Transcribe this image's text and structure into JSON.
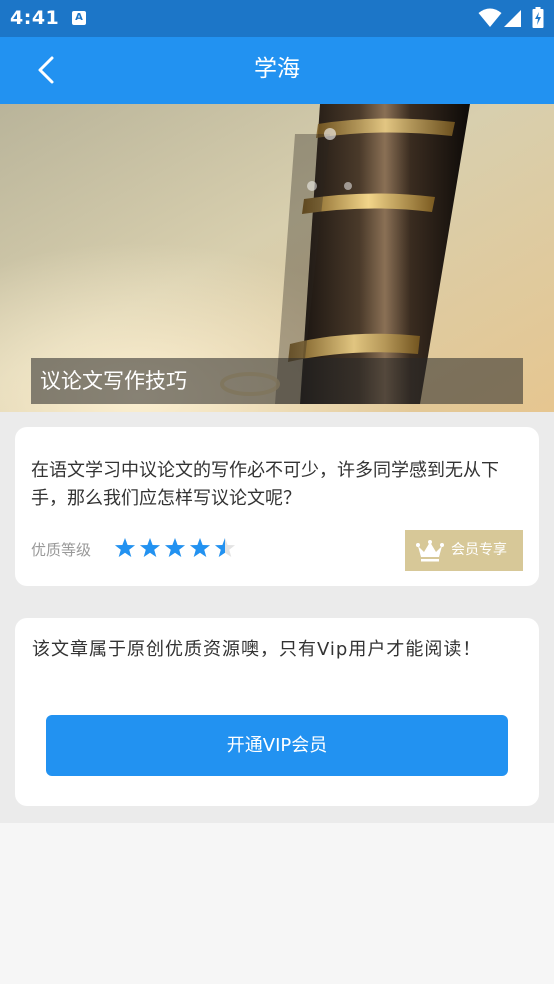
{
  "status_bar": {
    "time": "4:41",
    "notification_icon": "A"
  },
  "app_bar": {
    "title": "学海"
  },
  "hero": {
    "caption": "议论文写作技巧"
  },
  "article": {
    "summary": "在语文学习中议论文的写作必不可少，许多同学感到无从下手，那么我们应怎样写议论文呢？",
    "rating_label": "优质等级",
    "rating": 4.5,
    "rating_max": 5,
    "vip_badge_label": "会员专享"
  },
  "paywall": {
    "notice": "该文章属于原创优质资源噢，只有Vip用户才能阅读！",
    "button_label": "开通VIP会员"
  },
  "colors": {
    "status_bar": "#1c76c8",
    "app_bar": "#2292f1",
    "star": "#2292f1",
    "vip_badge": "#d7c898"
  }
}
